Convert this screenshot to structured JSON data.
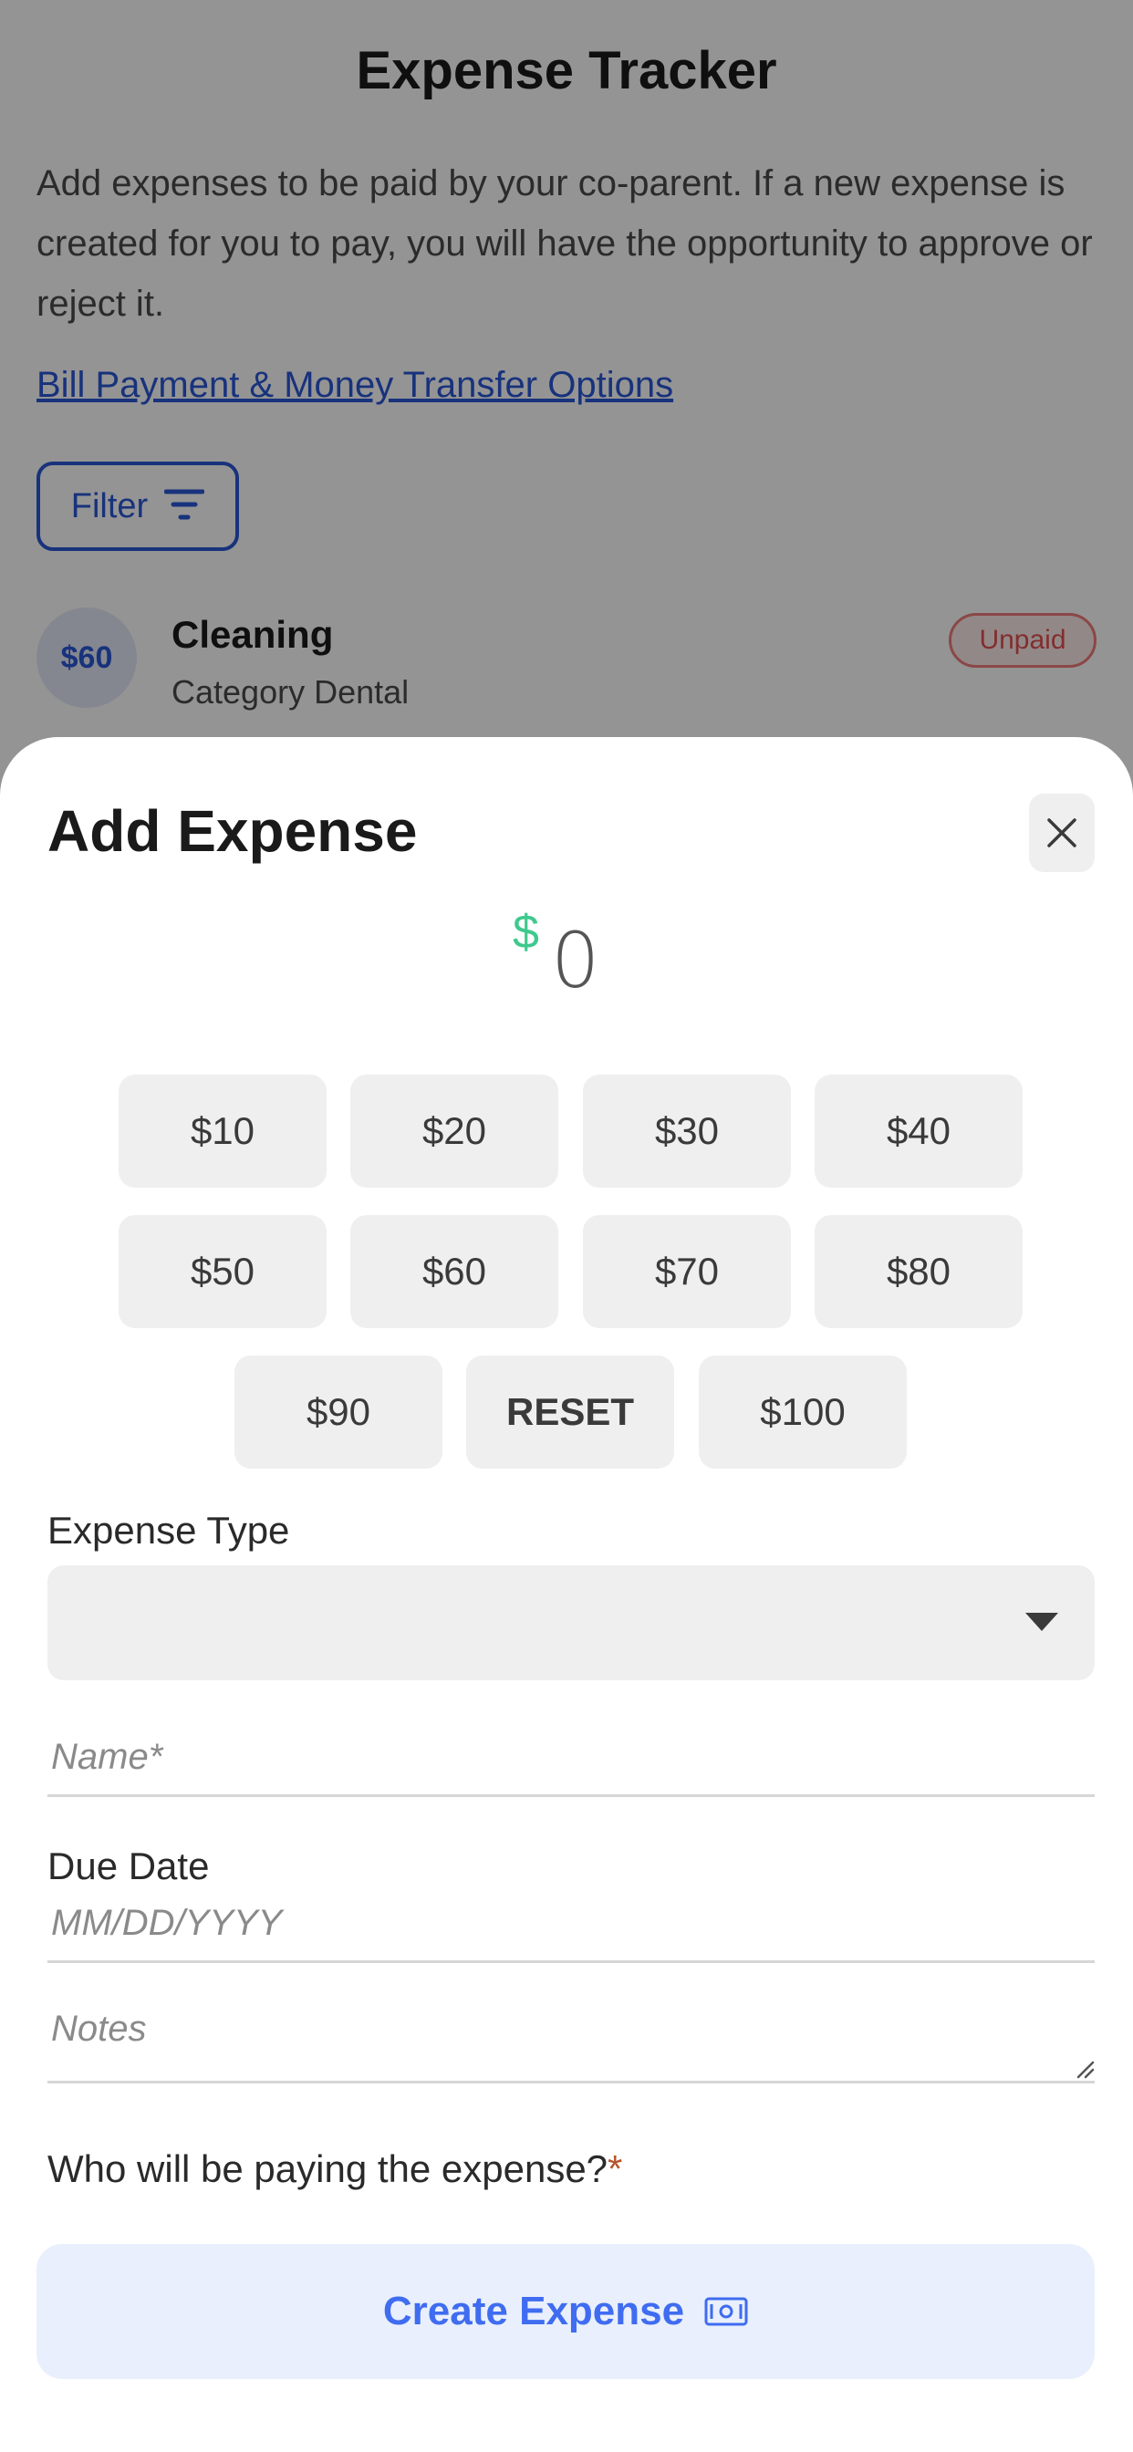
{
  "background": {
    "title": "Expense Tracker",
    "description": "Add expenses to be paid by your co-parent. If a new expense is created for you to pay, you will have the opportunity to approve or reject it.",
    "link": "Bill Payment & Money Transfer Options",
    "filter_label": "Filter",
    "expense_row": {
      "avatar_amount": "$60",
      "title": "Cleaning",
      "subtitle": "Category Dental",
      "badge": "Unpaid"
    }
  },
  "sheet": {
    "title": "Add Expense",
    "amount_symbol": "$",
    "amount_value": "0",
    "quick_amounts": [
      "$10",
      "$20",
      "$30",
      "$40",
      "$50",
      "$60",
      "$70",
      "$80",
      "$90",
      "RESET",
      "$100"
    ],
    "expense_type_label": "Expense Type",
    "expense_type_value": "",
    "name_placeholder": "Name*",
    "due_date_label": "Due Date",
    "due_date_placeholder": "MM/DD/YYYY",
    "notes_placeholder": "Notes",
    "payer_question": "Who will be paying the expense?",
    "payer_required_mark": "*",
    "create_button": "Create Expense"
  },
  "colors": {
    "accent_blue": "#3f6cf0",
    "money_green": "#3fc98d",
    "required_mark": "#b5542a",
    "unpaid_red": "#e05050"
  },
  "icons": [
    "filter-icon",
    "close-icon",
    "dropdown-caret-icon",
    "resize-handle-icon",
    "money-bill-icon"
  ]
}
